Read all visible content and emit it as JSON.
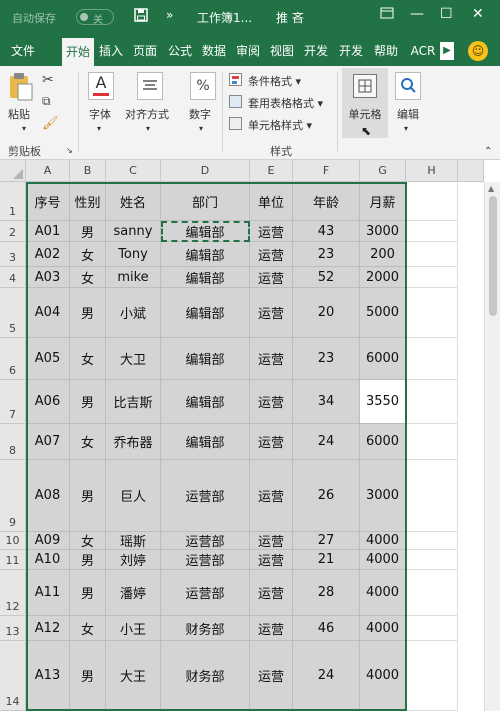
{
  "titlebar": {
    "autosave_label": "自动保存",
    "autosave_state": "关",
    "save_icon": "save-icon",
    "more_label": "»",
    "doc_name": "工作簿1...",
    "user_name": "推 吝",
    "minimize_label": "—",
    "restore_label": "☐",
    "close_label": "✕"
  },
  "tabs": [
    "文件",
    "开始",
    "插入",
    "页面",
    "公式",
    "数据",
    "审阅",
    "视图",
    "开发",
    "开发",
    "帮助",
    "ACR"
  ],
  "active_tab": "开始",
  "ribbon": {
    "paste_label": "粘贴",
    "clipboard_label": "剪贴板",
    "font_label": "字体",
    "align_label": "对齐方式",
    "number_label": "数字",
    "percent_symbol": "%",
    "conditional_format_label": "条件格式",
    "table_format_label": "套用表格格式",
    "cell_style_label": "单元格样式",
    "styles_label": "样式",
    "cells_label": "单元格",
    "edit_label": "编辑"
  },
  "columns": [
    "A",
    "B",
    "C",
    "D",
    "E",
    "F",
    "G",
    "H"
  ],
  "rows": [
    "1",
    "2",
    "3",
    "4",
    "5",
    "6",
    "7",
    "8",
    "9",
    "10",
    "11",
    "12",
    "13",
    "14"
  ],
  "table": {
    "headers": [
      "序号",
      "性别",
      "姓名",
      "部门",
      "单位",
      "年龄",
      "月薪"
    ],
    "data": [
      [
        "A01",
        "男",
        "sanny",
        "编辑部",
        "运营",
        "43",
        "3000"
      ],
      [
        "A02",
        "女",
        "Tony",
        "编辑部",
        "运营",
        "23",
        "200"
      ],
      [
        "A03",
        "女",
        "mike",
        "编辑部",
        "运营",
        "52",
        "2000"
      ],
      [
        "A04",
        "男",
        "小斌",
        "编辑部",
        "运营",
        "20",
        "5000"
      ],
      [
        "A05",
        "女",
        "大卫",
        "编辑部",
        "运营",
        "23",
        "6000"
      ],
      [
        "A06",
        "男",
        "比吉斯",
        "编辑部",
        "运营",
        "34",
        "3550"
      ],
      [
        "A07",
        "女",
        "乔布器",
        "编辑部",
        "运营",
        "24",
        "6000"
      ],
      [
        "A08",
        "男",
        "巨人",
        "运营部",
        "运营",
        "26",
        "3000"
      ],
      [
        "A09",
        "女",
        "瑶斯",
        "运营部",
        "运营",
        "27",
        "4000"
      ],
      [
        "A10",
        "男",
        "刘婷",
        "运营部",
        "运营",
        "21",
        "4000"
      ],
      [
        "A11",
        "男",
        "潘婷",
        "运营部",
        "运营",
        "28",
        "4000"
      ],
      [
        "A12",
        "女",
        "小王",
        "财务部",
        "运营",
        "46",
        "4000"
      ],
      [
        "A13",
        "男",
        "大王",
        "财务部",
        "运营",
        "24",
        "4000"
      ]
    ]
  },
  "colors": {
    "brand": "#217346",
    "selection_fill": "#d4d4d4"
  }
}
